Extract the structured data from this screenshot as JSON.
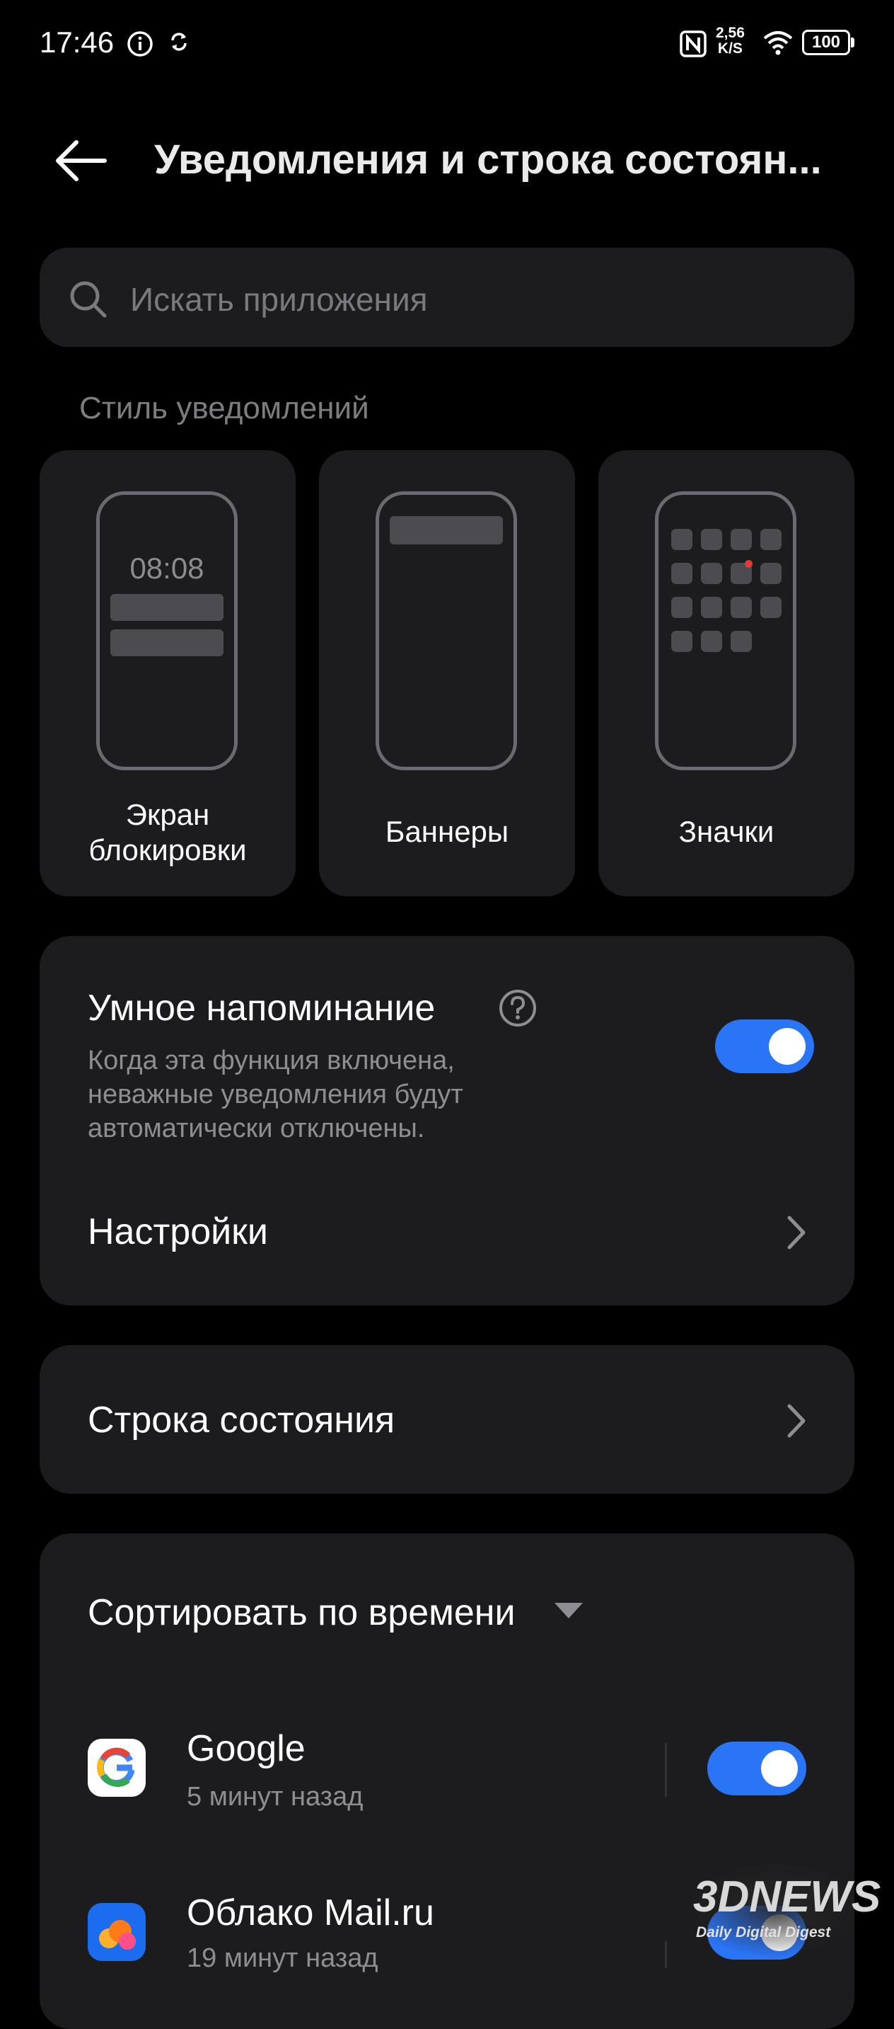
{
  "status_bar": {
    "time": "17:46",
    "speed_value": "2,56",
    "speed_unit": "K/S",
    "battery": "100"
  },
  "header": {
    "title": "Уведомления и строка состоян..."
  },
  "search": {
    "placeholder": "Искать приложения"
  },
  "notification_style": {
    "label": "Стиль уведомлений",
    "lock_screen": {
      "label_line1": "Экран",
      "label_line2": "блокировки",
      "clock": "08:08"
    },
    "banners": {
      "label": "Баннеры"
    },
    "badges": {
      "label": "Значки"
    }
  },
  "smart_reminder": {
    "title": "Умное напоминание",
    "description_line1": "Когда эта функция включена,",
    "description_line2": "неважные уведомления будут",
    "description_line3": "автоматически отключены.",
    "enabled": true,
    "settings_label": "Настройки"
  },
  "status_row": {
    "label": "Строка состояния"
  },
  "apps": {
    "sort_label": "Сортировать по времени",
    "items": [
      {
        "name": "Google",
        "time": "5 минут назад",
        "enabled": true
      },
      {
        "name": "Облако Mail.ru",
        "time": "19 минут назад",
        "enabled": true
      }
    ]
  },
  "watermark": {
    "brand": "3DNEWS",
    "tagline": "Daily Digital Digest"
  },
  "colors": {
    "background": "#000000",
    "card": "#1c1c1e",
    "accent": "#2a74f6",
    "secondary_text": "#8e8e92"
  }
}
